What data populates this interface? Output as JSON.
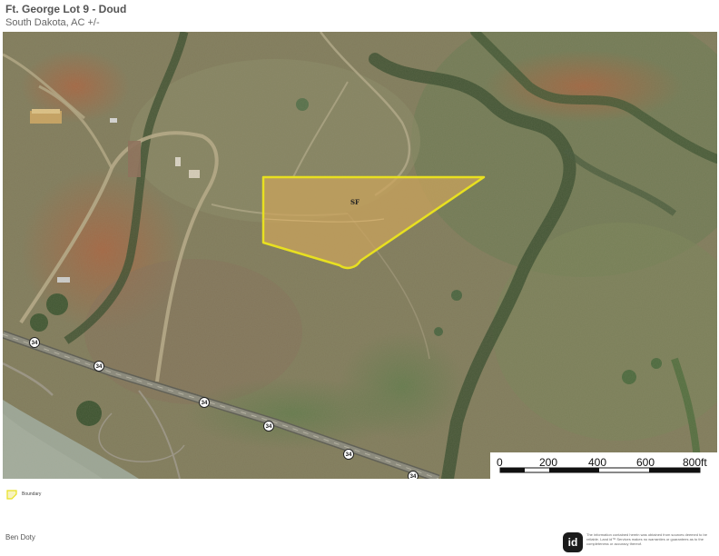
{
  "header": {
    "title": "Ft. George Lot 9 - Doud",
    "subtitle": "South Dakota,  AC +/-"
  },
  "map": {
    "parcel_label": "SF",
    "parcel_color": "#e8e020",
    "highway_shields": [
      "34",
      "34",
      "34",
      "34",
      "34",
      "34"
    ],
    "scale_labels": [
      "0",
      "200",
      "400",
      "600",
      "800ft"
    ]
  },
  "legend": {
    "boundary_label": "Boundary",
    "boundary_color": "#e8e020"
  },
  "footer": {
    "agent": "Ben Doty",
    "logo_text": "id",
    "disclaimer": "The information contained herein was obtained from sources deemed to be reliable. Land id™ Services makes no warranties or guarantees as to the completeness or accuracy thereof."
  }
}
